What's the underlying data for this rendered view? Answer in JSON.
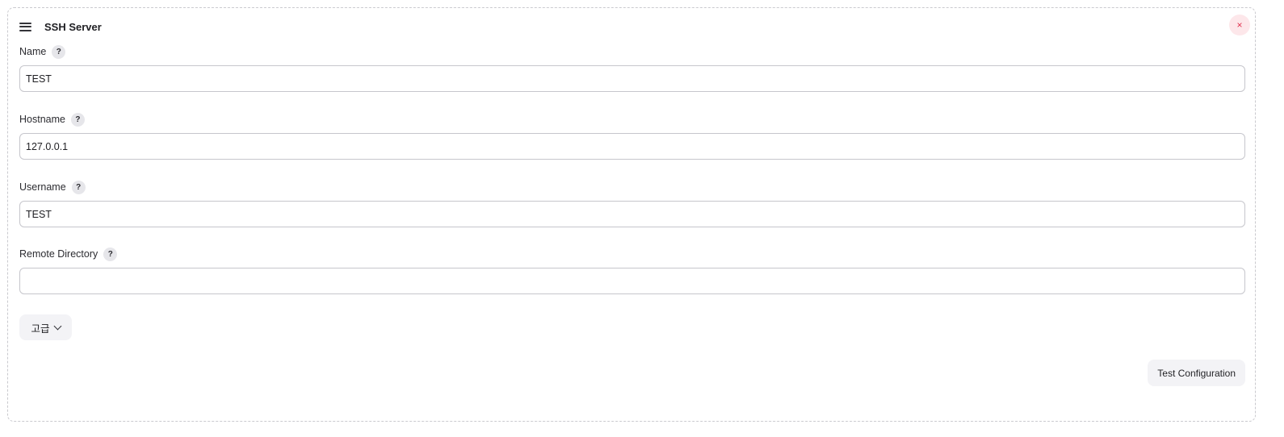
{
  "panel": {
    "title": "SSH Server",
    "drag_icon": "hamburger-icon",
    "close_icon": "close-icon",
    "close_glyph": "×"
  },
  "fields": [
    {
      "label": "Name",
      "value": "TEST",
      "help": "?"
    },
    {
      "label": "Hostname",
      "value": "127.0.0.1",
      "help": "?"
    },
    {
      "label": "Username",
      "value": "TEST",
      "help": "?"
    },
    {
      "label": "Remote Directory",
      "value": "",
      "help": "?"
    }
  ],
  "advanced": {
    "label": "고급",
    "icon": "chevron-down-icon"
  },
  "actions": {
    "test_configuration_label": "Test Configuration"
  },
  "colors": {
    "close_bg": "#fde7ea",
    "close_fg": "#e0334f",
    "button_bg": "#f3f3f6"
  }
}
